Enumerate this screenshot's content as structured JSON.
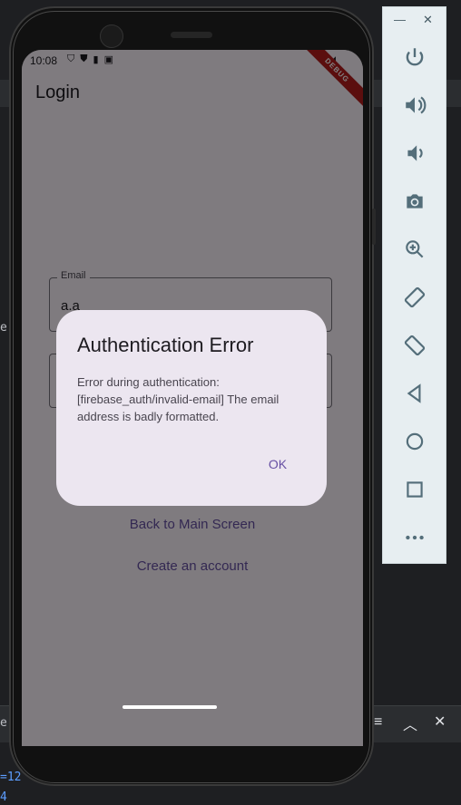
{
  "ide": {
    "left_fragment_1": "e]",
    "left_fragment_2": "e",
    "code_fragment_1": "=12",
    "code_fragment_2": "4"
  },
  "status_bar": {
    "time": "10:08"
  },
  "debug_banner": "DEBUG",
  "app": {
    "title": "Login",
    "email_label": "Email",
    "email_value": "a.a",
    "back_button": "Back to Main Screen",
    "create_account_button": "Create an account"
  },
  "dialog": {
    "title": "Authentication Error",
    "message": "Error during authentication: [firebase_auth/invalid-email] The email address is badly formatted.",
    "ok_label": "OK"
  },
  "emulator": {
    "buttons": [
      "power-icon",
      "volume-up-icon",
      "volume-down-icon",
      "camera-icon",
      "zoom-icon",
      "rotate-left-icon",
      "rotate-right-icon",
      "back-icon",
      "home-icon",
      "overview-icon",
      "more-icon"
    ]
  }
}
